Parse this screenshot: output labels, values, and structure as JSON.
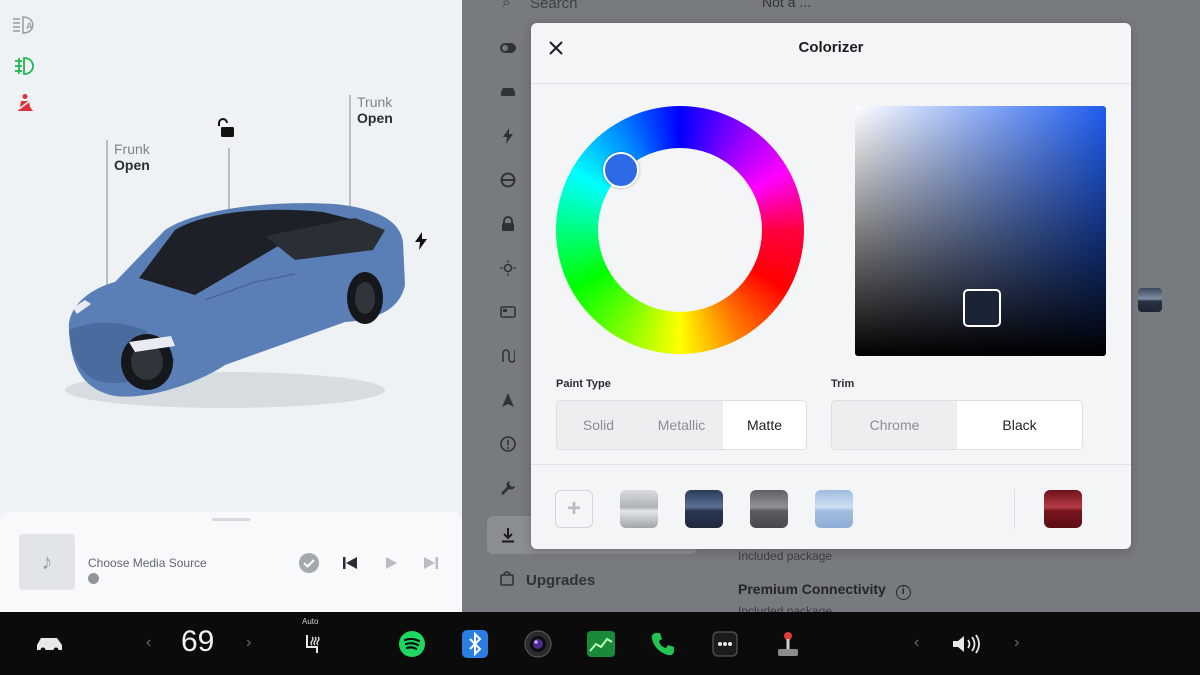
{
  "car_panel": {
    "frunk": {
      "label": "Frunk",
      "state": "Open"
    },
    "trunk": {
      "label": "Trunk",
      "state": "Open"
    },
    "lock_state": "unlocked",
    "car_color": "#5a7fb6",
    "telltales": [
      "auto-headlights-icon",
      "fog-light-icon",
      "seatbelt-warning-icon"
    ]
  },
  "media": {
    "title": "Choose Media Source",
    "controls": [
      "check-icon",
      "previous-track-icon",
      "play-icon",
      "next-track-icon"
    ]
  },
  "settings_bg": {
    "search_placeholder": "Search",
    "top_text": "Not a ...",
    "upgrades_label": "Upgrades",
    "included_text": "Included package",
    "premium_label": "Premium Connectivity",
    "included_text_2": "Included package"
  },
  "colorizer": {
    "title": "Colorizer",
    "selected_color": "#2e6ae8",
    "paint_type_label": "Paint Type",
    "paint_types": [
      "Solid",
      "Metallic",
      "Matte"
    ],
    "paint_type_selected": "Matte",
    "trim_label": "Trim",
    "trims": [
      "Chrome",
      "Black"
    ],
    "trim_selected": "Black",
    "saved_swatches": [
      "#b9bec2",
      "#3f5378",
      "#7c7e81",
      "#b3cbe6"
    ],
    "preset_swatch": "#8a1c26"
  },
  "taskbar": {
    "temperature": "69",
    "seat_heat_mode": "Auto",
    "apps": [
      "spotify-icon",
      "bluetooth-icon",
      "camera-icon",
      "energy-icon",
      "phone-icon",
      "more-icon",
      "toybox-icon"
    ],
    "volume_icon": "volume-icon"
  }
}
